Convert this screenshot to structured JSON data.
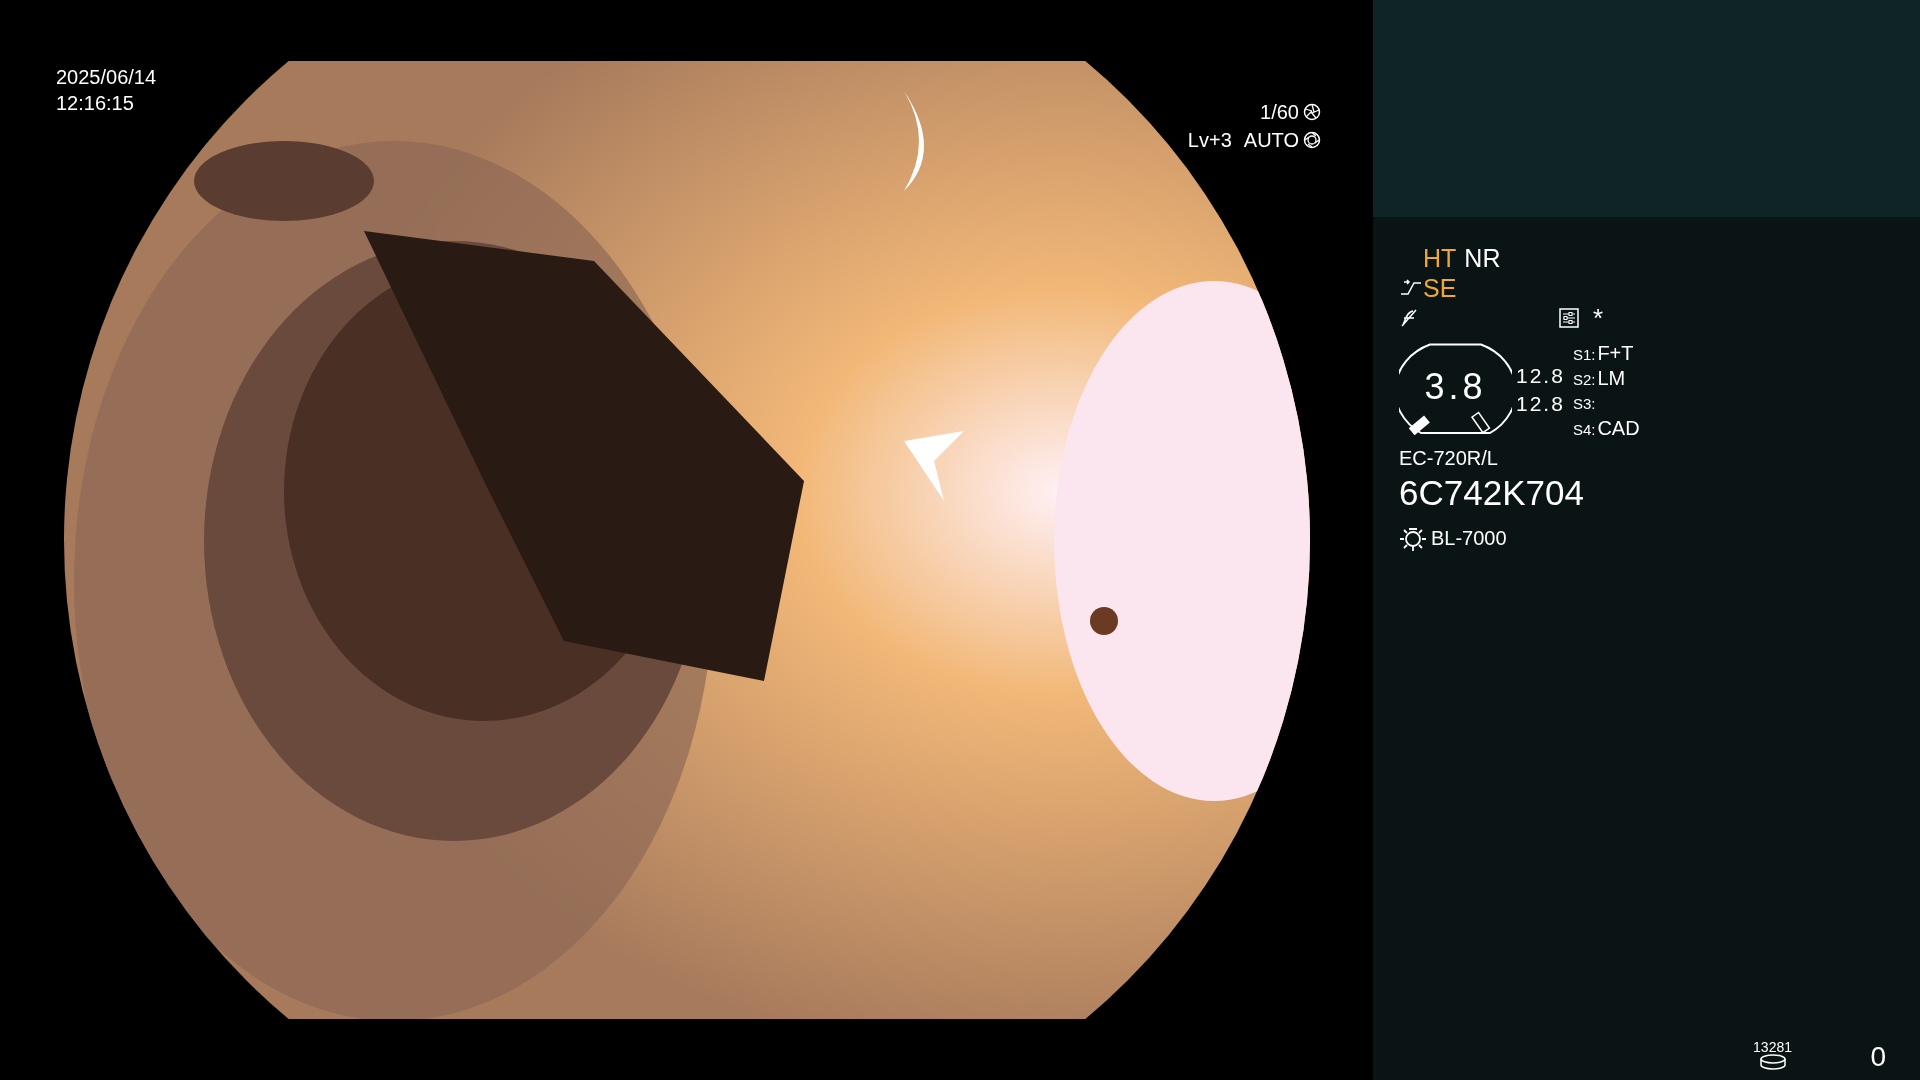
{
  "datetime": {
    "date": "2025/06/14",
    "time": "12:16:15"
  },
  "shutter": "1/60",
  "exposure": {
    "level_text": "Lv+3",
    "mode": "AUTO"
  },
  "modes": [
    {
      "label": "HT",
      "color": "#f0a830"
    },
    {
      "label": "NR",
      "color": "#ffffff"
    }
  ],
  "enhancement": {
    "label": "SE",
    "color": "#f0a830"
  },
  "asterisk": "*",
  "iris": {
    "value": "3.8",
    "readings": [
      "12.8",
      "12.8"
    ]
  },
  "switches": [
    {
      "key": "S1:",
      "value": "F+T"
    },
    {
      "key": "S2:",
      "value": "LM"
    },
    {
      "key": "S3:"
    },
    {
      "key": "S4:",
      "value": "CAD"
    }
  ],
  "scope": {
    "model": "EC-720R/L",
    "serial": "6C742K704"
  },
  "light_source": "BL-7000",
  "storage": {
    "count": "13281"
  },
  "counter": "0"
}
